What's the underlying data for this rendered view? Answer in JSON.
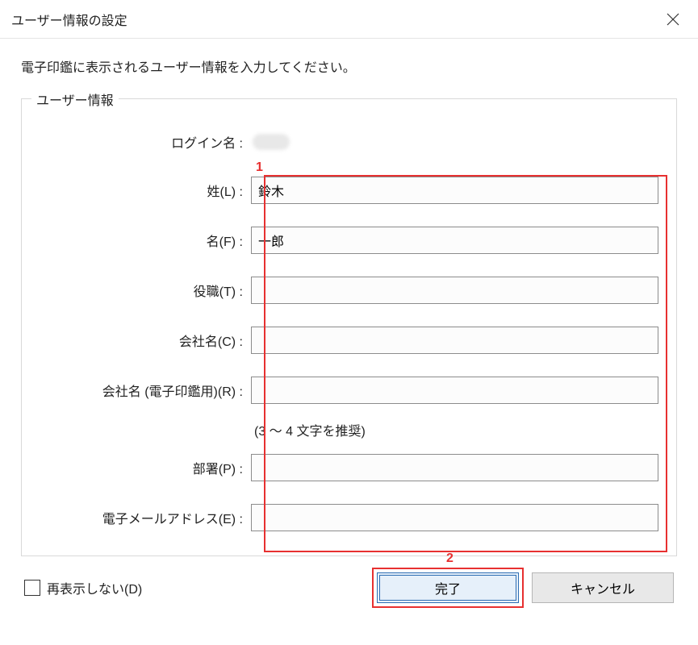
{
  "title": "ユーザー情報の設定",
  "description": "電子印鑑に表示されるユーザー情報を入力してください。",
  "group_label": "ユーザー情報",
  "fields": {
    "login": {
      "label": "ログイン名 :"
    },
    "surname": {
      "label": "姓(L) :",
      "value": "鈴木"
    },
    "given": {
      "label": "名(F) :",
      "value": "一郎"
    },
    "title": {
      "label": "役職(T) :",
      "value": ""
    },
    "company": {
      "label": "会社名(C) :",
      "value": ""
    },
    "company_stamp": {
      "label": "会社名 (電子印鑑用)(R) :",
      "value": ""
    },
    "stamp_hint": "(3 ～ 4 文字を推奨)",
    "department": {
      "label": "部署(P) :",
      "value": ""
    },
    "email": {
      "label": "電子メールアドレス(E) :",
      "value": ""
    }
  },
  "checkbox_label": "再表示しない(D)",
  "buttons": {
    "ok": "完了",
    "cancel": "キャンセル"
  },
  "annotations": {
    "one": "1",
    "two": "2"
  }
}
